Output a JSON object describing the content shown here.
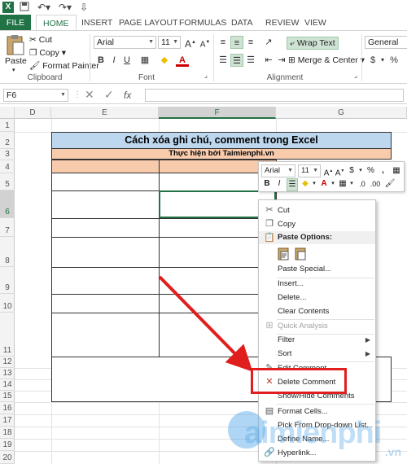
{
  "titlebar": {
    "logo": "X",
    "undo_icon": "undo-icon",
    "redo_icon": "redo-icon"
  },
  "tabs": [
    "FILE",
    "HOME",
    "INSERT",
    "PAGE LAYOUT",
    "FORMULAS",
    "DATA",
    "REVIEW",
    "VIEW"
  ],
  "active_tab": "HOME",
  "ribbon": {
    "clipboard": {
      "paste": "Paste",
      "cut": "Cut",
      "copy": "Copy",
      "format_painter": "Format Painter",
      "label": "Clipboard"
    },
    "font": {
      "name": "Arial",
      "size": "11",
      "label": "Font",
      "bold": "B",
      "italic": "I",
      "underline": "U",
      "grow": "A",
      "shrink": "A"
    },
    "alignment": {
      "wrap_text": "Wrap Text",
      "merge_center": "Merge & Center",
      "label": "Alignment"
    },
    "number": {
      "format": "General",
      "currency": "$",
      "percent": "%"
    }
  },
  "formula_bar": {
    "name_box": "F6",
    "fx": "fx"
  },
  "columns": [
    "D",
    "E",
    "F",
    "G"
  ],
  "selected_column": "F",
  "rows": [
    "1",
    "2",
    "3",
    "4",
    "5",
    "6",
    "7",
    "8",
    "9",
    "10",
    "11",
    "12",
    "13",
    "14",
    "15",
    "16",
    "17",
    "18",
    "19",
    "20"
  ],
  "selected_row": "6",
  "sheet": {
    "title": "Cách xóa ghi chú, comment trong Excel",
    "subtitle": "Thực hiện bởi Taimienphi.vn"
  },
  "mini_toolbar": {
    "font": "Arial",
    "size": "11",
    "bold": "B",
    "italic": "I",
    "percent": "%",
    "currency": "$",
    "comma": ","
  },
  "context_menu": {
    "cut": "Cut",
    "copy": "Copy",
    "paste_options": "Paste Options:",
    "paste_special": "Paste Special...",
    "insert": "Insert...",
    "delete": "Delete...",
    "clear_contents": "Clear Contents",
    "quick_analysis": "Quick Analysis",
    "filter": "Filter",
    "sort": "Sort",
    "edit_comment": "Edit Comment",
    "delete_comment": "Delete Comment",
    "show_hide_comments": "Show/Hide Comments",
    "format_cells": "Format Cells...",
    "pick_from_list": "Pick From Drop-down List...",
    "define_name": "Define Name...",
    "hyperlink": "Hyperlink..."
  },
  "watermark": {
    "text": "aimienphi",
    "suffix": ".vn"
  },
  "colors": {
    "excel_green": "#217346",
    "title_fill": "#bdd7ee",
    "sub_fill": "#f8cbad",
    "highlight": "#e01e1e"
  }
}
